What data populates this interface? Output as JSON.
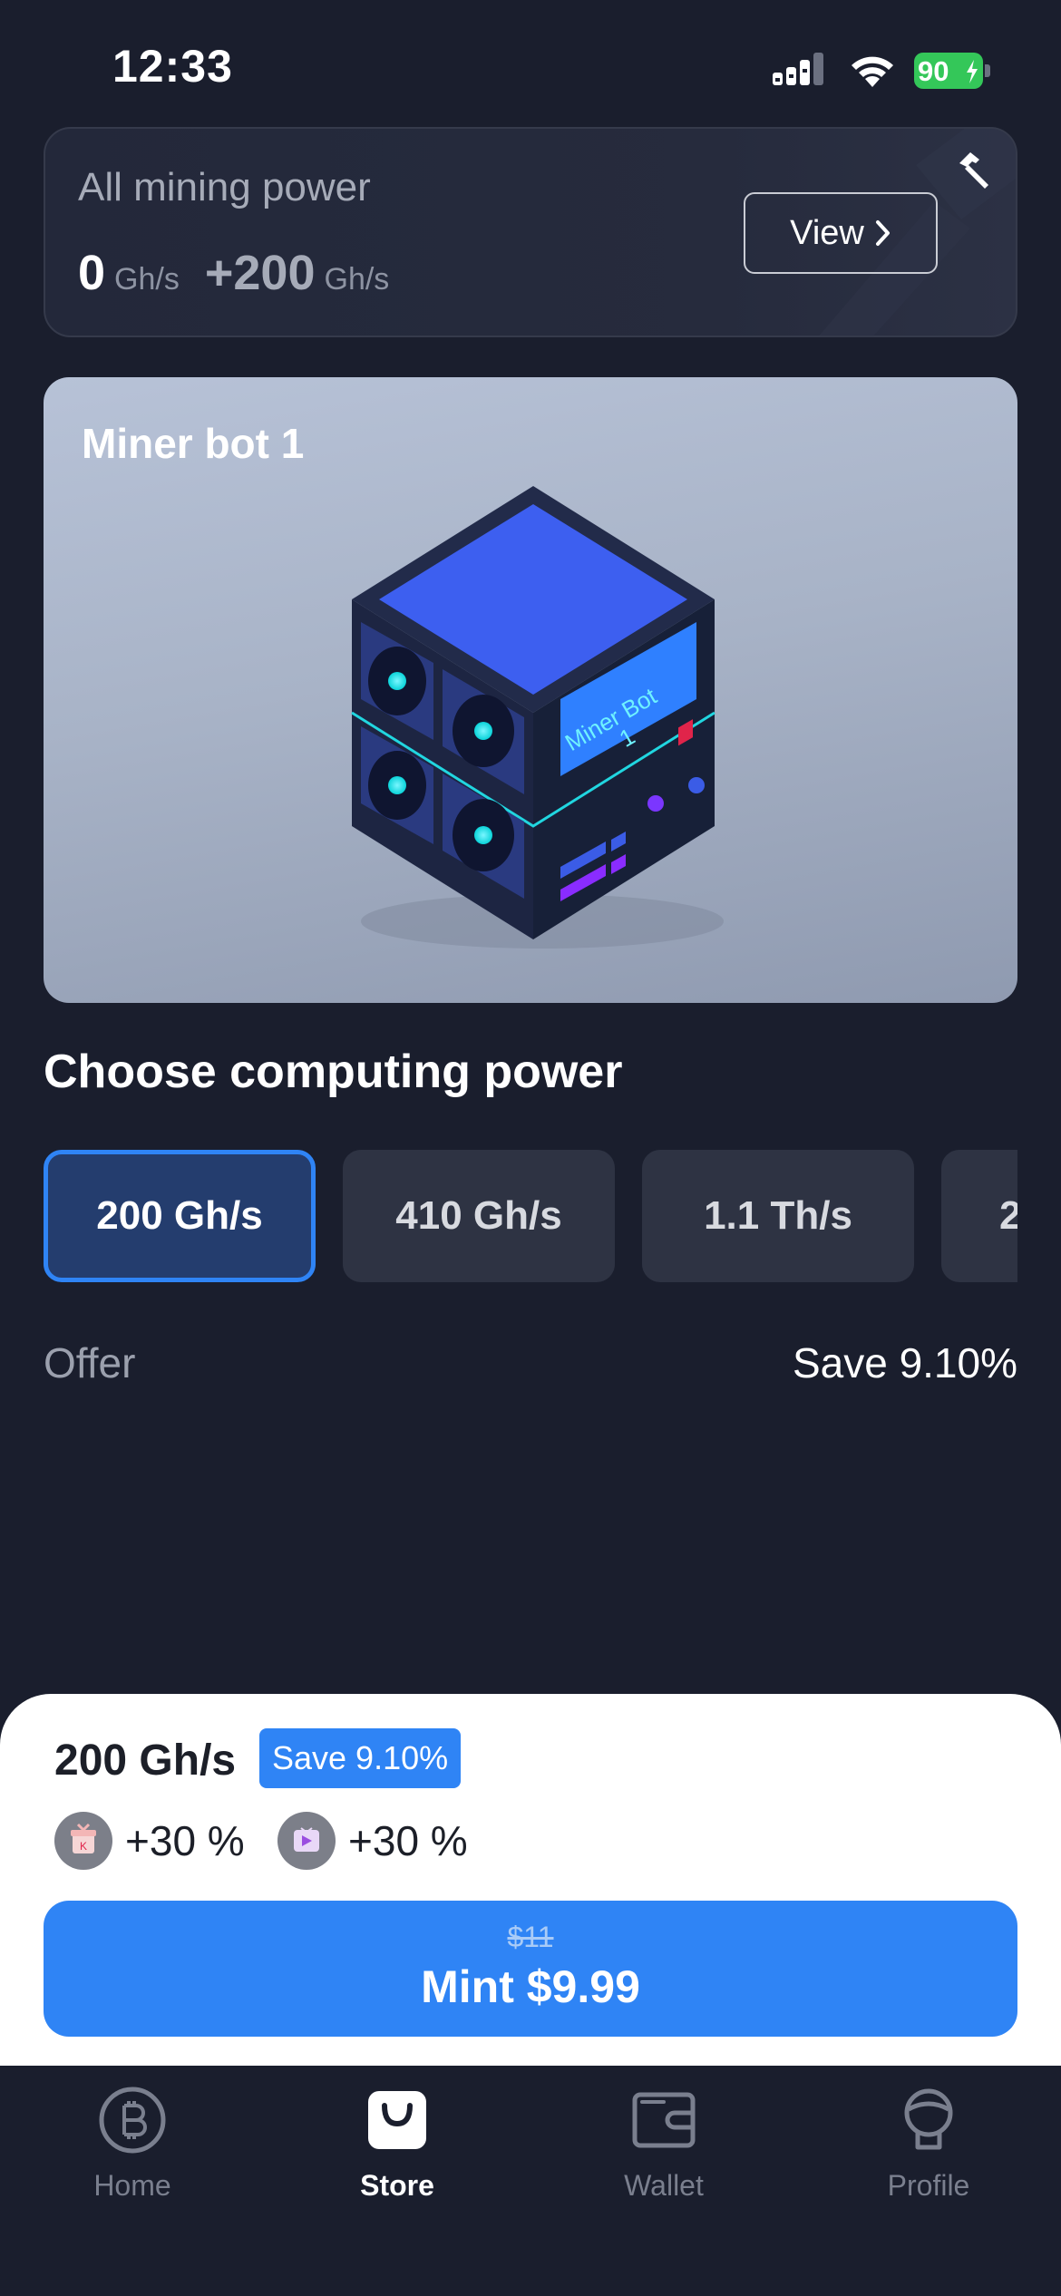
{
  "status_bar": {
    "time": "12:33",
    "battery": "90"
  },
  "mining_power": {
    "title": "All mining power",
    "current_value": "0",
    "current_unit": "Gh/s",
    "bonus_value": "+200",
    "bonus_unit": "Gh/s",
    "view_label": "View"
  },
  "miner": {
    "title": "Miner bot 1",
    "screen_line1": "Miner Bot",
    "screen_line2": "1"
  },
  "computing": {
    "title": "Choose computing power",
    "options": [
      {
        "label": "200 Gh/s",
        "selected": true
      },
      {
        "label": "410 Gh/s",
        "selected": false
      },
      {
        "label": "1.1 Th/s",
        "selected": false
      },
      {
        "label": "2",
        "selected": false
      }
    ],
    "offer_label": "Offer",
    "offer_value": "Save 9.10%"
  },
  "purchase": {
    "power": "200 Gh/s",
    "badge": "Save 9.10%",
    "boost_1": "+30 %",
    "boost_2": "+30 %",
    "old_price": "$11",
    "mint_label": "Mint $9.99"
  },
  "tabs": [
    {
      "label": "Home",
      "icon": "bitcoin-icon",
      "active": false
    },
    {
      "label": "Store",
      "icon": "shopping-bag-icon",
      "active": true
    },
    {
      "label": "Wallet",
      "icon": "wallet-icon",
      "active": false
    },
    {
      "label": "Profile",
      "icon": "profile-icon",
      "active": false
    }
  ],
  "colors": {
    "background": "#1a1e2d",
    "accent": "#2f84f5",
    "card": "#2e3343",
    "battery": "#34c759"
  }
}
